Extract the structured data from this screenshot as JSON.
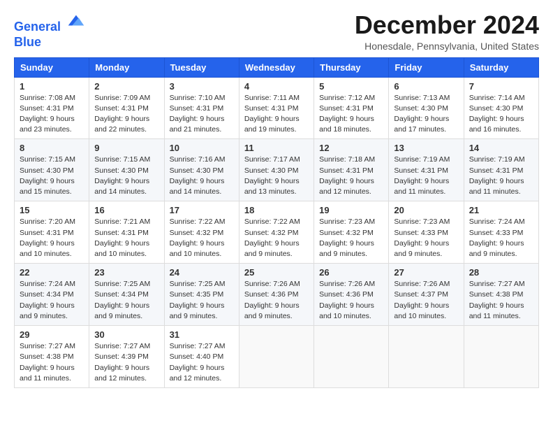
{
  "logo": {
    "line1": "General",
    "line2": "Blue"
  },
  "title": "December 2024",
  "subtitle": "Honesdale, Pennsylvania, United States",
  "days_of_week": [
    "Sunday",
    "Monday",
    "Tuesday",
    "Wednesday",
    "Thursday",
    "Friday",
    "Saturday"
  ],
  "weeks": [
    [
      {
        "day": "1",
        "sunrise": "7:08 AM",
        "sunset": "4:31 PM",
        "daylight": "9 hours and 23 minutes."
      },
      {
        "day": "2",
        "sunrise": "7:09 AM",
        "sunset": "4:31 PM",
        "daylight": "9 hours and 22 minutes."
      },
      {
        "day": "3",
        "sunrise": "7:10 AM",
        "sunset": "4:31 PM",
        "daylight": "9 hours and 21 minutes."
      },
      {
        "day": "4",
        "sunrise": "7:11 AM",
        "sunset": "4:31 PM",
        "daylight": "9 hours and 19 minutes."
      },
      {
        "day": "5",
        "sunrise": "7:12 AM",
        "sunset": "4:31 PM",
        "daylight": "9 hours and 18 minutes."
      },
      {
        "day": "6",
        "sunrise": "7:13 AM",
        "sunset": "4:30 PM",
        "daylight": "9 hours and 17 minutes."
      },
      {
        "day": "7",
        "sunrise": "7:14 AM",
        "sunset": "4:30 PM",
        "daylight": "9 hours and 16 minutes."
      }
    ],
    [
      {
        "day": "8",
        "sunrise": "7:15 AM",
        "sunset": "4:30 PM",
        "daylight": "9 hours and 15 minutes."
      },
      {
        "day": "9",
        "sunrise": "7:15 AM",
        "sunset": "4:30 PM",
        "daylight": "9 hours and 14 minutes."
      },
      {
        "day": "10",
        "sunrise": "7:16 AM",
        "sunset": "4:30 PM",
        "daylight": "9 hours and 14 minutes."
      },
      {
        "day": "11",
        "sunrise": "7:17 AM",
        "sunset": "4:30 PM",
        "daylight": "9 hours and 13 minutes."
      },
      {
        "day": "12",
        "sunrise": "7:18 AM",
        "sunset": "4:31 PM",
        "daylight": "9 hours and 12 minutes."
      },
      {
        "day": "13",
        "sunrise": "7:19 AM",
        "sunset": "4:31 PM",
        "daylight": "9 hours and 11 minutes."
      },
      {
        "day": "14",
        "sunrise": "7:19 AM",
        "sunset": "4:31 PM",
        "daylight": "9 hours and 11 minutes."
      }
    ],
    [
      {
        "day": "15",
        "sunrise": "7:20 AM",
        "sunset": "4:31 PM",
        "daylight": "9 hours and 10 minutes."
      },
      {
        "day": "16",
        "sunrise": "7:21 AM",
        "sunset": "4:31 PM",
        "daylight": "9 hours and 10 minutes."
      },
      {
        "day": "17",
        "sunrise": "7:22 AM",
        "sunset": "4:32 PM",
        "daylight": "9 hours and 10 minutes."
      },
      {
        "day": "18",
        "sunrise": "7:22 AM",
        "sunset": "4:32 PM",
        "daylight": "9 hours and 9 minutes."
      },
      {
        "day": "19",
        "sunrise": "7:23 AM",
        "sunset": "4:32 PM",
        "daylight": "9 hours and 9 minutes."
      },
      {
        "day": "20",
        "sunrise": "7:23 AM",
        "sunset": "4:33 PM",
        "daylight": "9 hours and 9 minutes."
      },
      {
        "day": "21",
        "sunrise": "7:24 AM",
        "sunset": "4:33 PM",
        "daylight": "9 hours and 9 minutes."
      }
    ],
    [
      {
        "day": "22",
        "sunrise": "7:24 AM",
        "sunset": "4:34 PM",
        "daylight": "9 hours and 9 minutes."
      },
      {
        "day": "23",
        "sunrise": "7:25 AM",
        "sunset": "4:34 PM",
        "daylight": "9 hours and 9 minutes."
      },
      {
        "day": "24",
        "sunrise": "7:25 AM",
        "sunset": "4:35 PM",
        "daylight": "9 hours and 9 minutes."
      },
      {
        "day": "25",
        "sunrise": "7:26 AM",
        "sunset": "4:36 PM",
        "daylight": "9 hours and 9 minutes."
      },
      {
        "day": "26",
        "sunrise": "7:26 AM",
        "sunset": "4:36 PM",
        "daylight": "9 hours and 10 minutes."
      },
      {
        "day": "27",
        "sunrise": "7:26 AM",
        "sunset": "4:37 PM",
        "daylight": "9 hours and 10 minutes."
      },
      {
        "day": "28",
        "sunrise": "7:27 AM",
        "sunset": "4:38 PM",
        "daylight": "9 hours and 11 minutes."
      }
    ],
    [
      {
        "day": "29",
        "sunrise": "7:27 AM",
        "sunset": "4:38 PM",
        "daylight": "9 hours and 11 minutes."
      },
      {
        "day": "30",
        "sunrise": "7:27 AM",
        "sunset": "4:39 PM",
        "daylight": "9 hours and 12 minutes."
      },
      {
        "day": "31",
        "sunrise": "7:27 AM",
        "sunset": "4:40 PM",
        "daylight": "9 hours and 12 minutes."
      },
      null,
      null,
      null,
      null
    ]
  ],
  "labels": {
    "sunrise": "Sunrise:",
    "sunset": "Sunset:",
    "daylight": "Daylight:"
  }
}
